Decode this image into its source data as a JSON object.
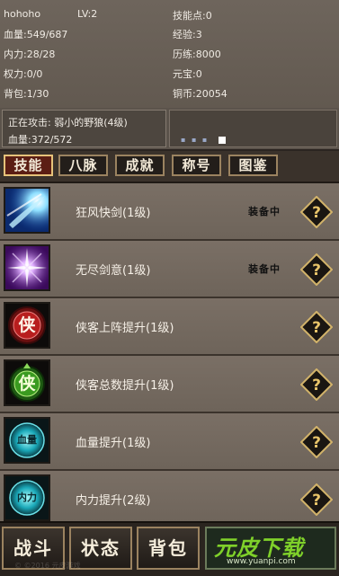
{
  "stats": {
    "name": "hohoho",
    "level": "LV:2",
    "hp": "血量:549/687",
    "mp": "内力:28/28",
    "power": "权力:0/0",
    "bag": "背包:1/30",
    "skill_points": "技能点:0",
    "exp": "经验:3",
    "experience": "历练:8000",
    "yuanbao": "元宝:0",
    "copper": "铜币:20054"
  },
  "attack": {
    "target": "正在攻击: 弱小的野狼(4级)",
    "target_hp": "血量:372/572"
  },
  "tabs": [
    "技能",
    "八脉",
    "成就",
    "称号",
    "图鉴"
  ],
  "active_tab": "技能",
  "skills": [
    {
      "name": "狂风快剑(1级)",
      "equipped": "装备中",
      "icon": "blue-wind-sword-icon"
    },
    {
      "name": "无尽剑意(1级)",
      "equipped": "装备中",
      "icon": "purple-burst-icon"
    },
    {
      "name": "侠客上阵提升(1级)",
      "equipped": "",
      "icon": "xia-red-badge-icon"
    },
    {
      "name": "侠客总数提升(1级)",
      "equipped": "",
      "icon": "xia-green-badge-icon"
    },
    {
      "name": "血量提升(1级)",
      "equipped": "",
      "icon": "hp-boost-icon"
    },
    {
      "name": "内力提升(2级)",
      "equipped": "",
      "icon": "mp-boost-icon"
    }
  ],
  "icon_labels": {
    "xia": "侠",
    "xueliang": "血量",
    "neili": "内力"
  },
  "bottom": {
    "battle": "战斗",
    "status": "状态",
    "bag": "背包"
  },
  "brand": {
    "logo": "元皮下载",
    "url": "www.yuanpi.com"
  },
  "watermark": "© ©2016 元皮游戏"
}
